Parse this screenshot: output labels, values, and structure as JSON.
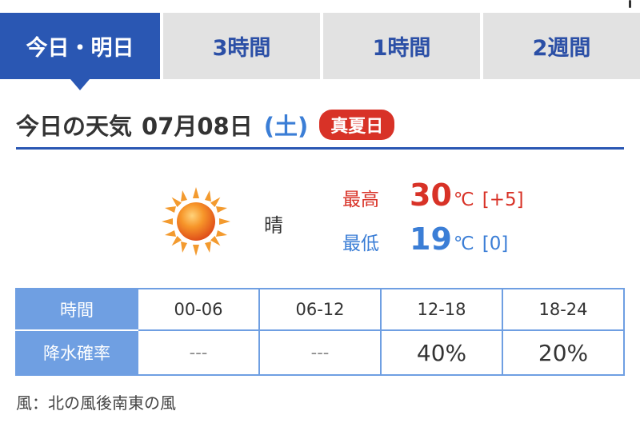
{
  "tabs": [
    "今日・明日",
    "3時間",
    "1時間",
    "2週間"
  ],
  "heading": {
    "title": "今日の天気",
    "date": "07月08日",
    "day_of_week": "(土)",
    "badge": "真夏日"
  },
  "weather": {
    "icon": "sun-icon",
    "condition": "晴",
    "high": {
      "label": "最高",
      "value": "30",
      "unit": "℃",
      "diff": "[+5]"
    },
    "low": {
      "label": "最低",
      "value": "19",
      "unit": "℃",
      "diff": "[0]"
    }
  },
  "rain_table": {
    "row1_header": "時間",
    "periods": [
      "00-06",
      "06-12",
      "12-18",
      "18-24"
    ],
    "row2_header": "降水確率",
    "probabilities": [
      "---",
      "---",
      "40%",
      "20%"
    ]
  },
  "wind": "風：北の風後南東の風",
  "colors": {
    "accent_blue": "#2a57b3",
    "table_blue": "#6f9fe2",
    "high_red": "#d83227",
    "low_blue": "#3b7ed6"
  }
}
